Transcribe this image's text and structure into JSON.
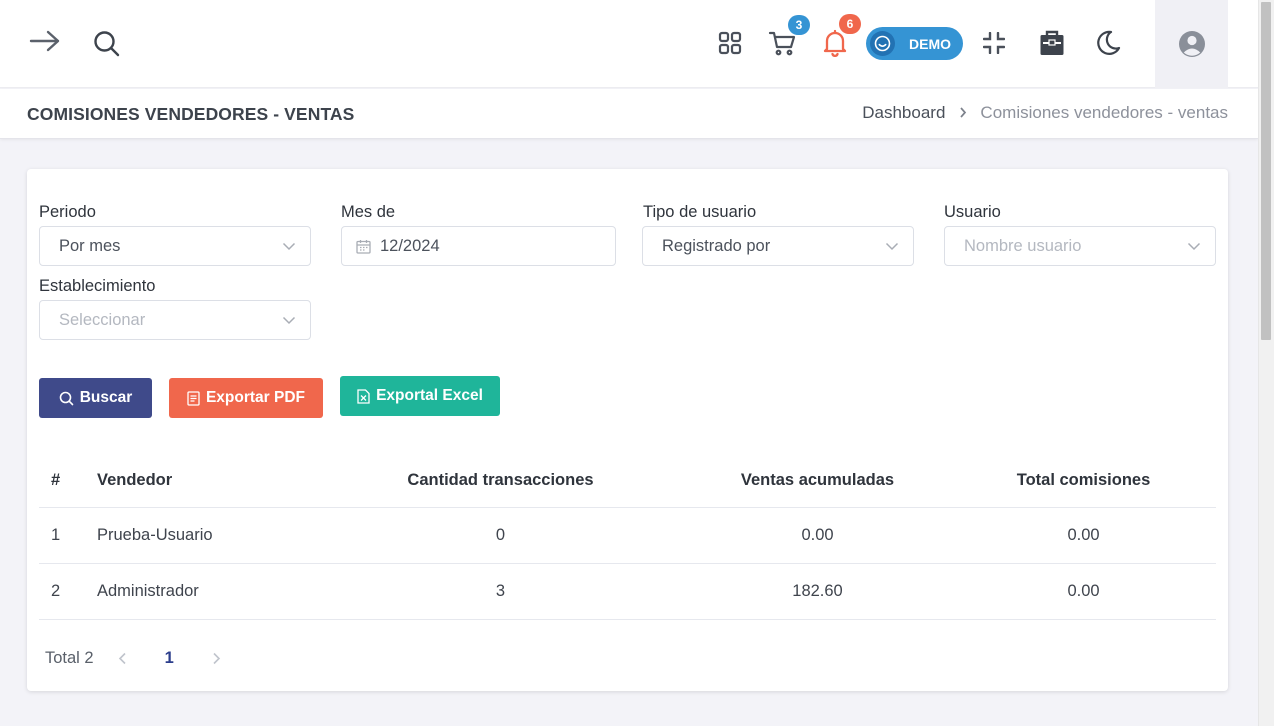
{
  "colors": {
    "primary": "#3f4a8a",
    "danger": "#f0674c",
    "success": "#1fb59a",
    "demo": "#3594d4",
    "badge_cart": "#3594d4",
    "badge_bell": "#f0674c"
  },
  "topbar": {
    "icons": [
      "menu-arrow-icon",
      "search-icon",
      "apps-grid-icon",
      "cart-icon",
      "bell-icon",
      "fullscreen-exit-icon",
      "store-icon",
      "moon-icon",
      "user-avatar-icon"
    ],
    "cart_badge": "3",
    "bell_badge": "6",
    "demo_label": "DEMO"
  },
  "header": {
    "title": "COMISIONES VENDEDORES - VENTAS",
    "breadcrumb": [
      "Dashboard",
      "Comisiones vendedores - ventas"
    ]
  },
  "filters": {
    "periodo": {
      "label": "Periodo",
      "value": "Por mes"
    },
    "mes": {
      "label": "Mes de",
      "value": "12/2024"
    },
    "tipo_usuario": {
      "label": "Tipo de usuario",
      "value": "Registrado por"
    },
    "usuario": {
      "label": "Usuario",
      "placeholder": "Nombre usuario"
    },
    "establecimiento": {
      "label": "Establecimiento",
      "placeholder": "Seleccionar"
    }
  },
  "actions": {
    "search": "Buscar",
    "pdf": "Exportar PDF",
    "excel": "Exportal Excel"
  },
  "table": {
    "columns": [
      "#",
      "Vendedor",
      "Cantidad transacciones",
      "Ventas acumuladas",
      "Total comisiones"
    ],
    "rows": [
      [
        "1",
        "Prueba-Usuario",
        "0",
        "0.00",
        "0.00"
      ],
      [
        "2",
        "Administrador",
        "3",
        "182.60",
        "0.00"
      ]
    ]
  },
  "pagination": {
    "total": "Total 2",
    "current_page": "1"
  }
}
